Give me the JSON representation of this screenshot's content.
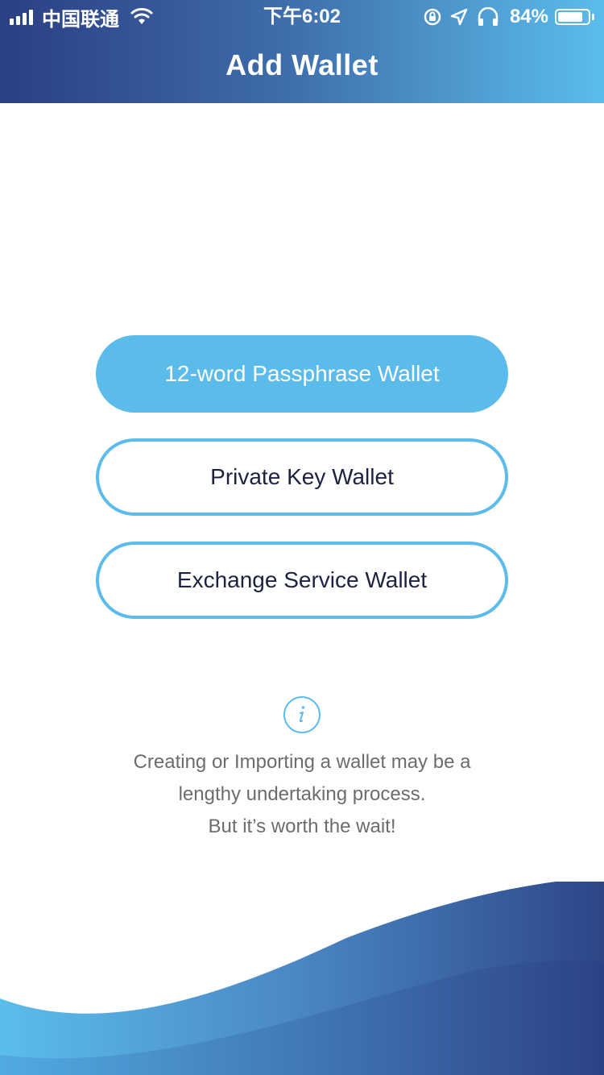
{
  "status_bar": {
    "carrier": "中国联通",
    "time": "下午6:02",
    "battery": "84%",
    "battery_level": 0.84
  },
  "header": {
    "title": "Add Wallet"
  },
  "buttons": {
    "passphrase": "12-word Passphrase Wallet",
    "private_key": "Private Key Wallet",
    "exchange": "Exchange Service Wallet"
  },
  "info": {
    "icon": "info-icon",
    "line1": "Creating or Importing a wallet may be a",
    "line2": "lengthy undertaking process.",
    "line3": "But it’s worth the wait!"
  },
  "colors": {
    "accent": "#5bbbea",
    "header_dark": "#2b3f85",
    "text_dark": "#1c2240"
  }
}
